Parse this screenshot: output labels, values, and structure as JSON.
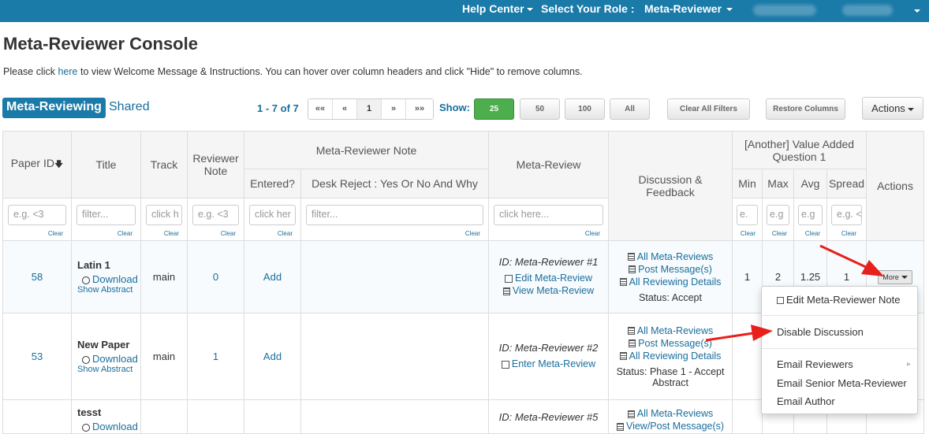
{
  "topbar": {
    "help_center": "Help Center",
    "select_role_label": "Select Your Role :",
    "role": "Meta-Reviewer"
  },
  "page": {
    "title": "Meta-Reviewer Console",
    "instructions_prefix": "Please click ",
    "instructions_link": "here",
    "instructions_suffix": " to view Welcome Message & Instructions. You can hover over column headers and click \"Hide\" to remove columns."
  },
  "tabs": {
    "active": "Meta-Reviewing",
    "shared": "Shared"
  },
  "pagination": {
    "range": "1 - 7 of 7",
    "first": "««",
    "prev": "«",
    "current": "1",
    "next": "»",
    "last": "»»",
    "show_label": "Show:",
    "sizes": [
      "25",
      "50",
      "100",
      "All"
    ]
  },
  "toolbar": {
    "clear_filters": "Clear All Filters",
    "restore_columns": "Restore Columns",
    "actions": "Actions"
  },
  "headers": {
    "paper_id": "Paper ID",
    "title": "Title",
    "track": "Track",
    "reviewer_note_1": "Reviewer",
    "reviewer_note_2": "Note",
    "mr_note": "Meta-Reviewer Note",
    "entered": "Entered?",
    "desk_reject": "Desk Reject : Yes Or No And Why",
    "meta_review": "Meta-Review",
    "discussion_1": "Discussion &",
    "discussion_2": "Feedback",
    "value_added_1": "[Another] Value Added",
    "value_added_2": "Question 1",
    "min": "Min",
    "max": "Max",
    "avg": "Avg",
    "spread": "Spread",
    "actions": "Actions"
  },
  "filters": {
    "paper_id": "e.g. <3",
    "title": "filter...",
    "track": "click h",
    "reviewer_note": "e.g. <3",
    "entered": "click her",
    "desk_reject": "filter...",
    "meta_review": "click here...",
    "min": "e.",
    "max": "e.g",
    "avg": "e.g",
    "spread": "e.g. <",
    "clear": "Clear"
  },
  "rows": [
    {
      "paper_id": "58",
      "title": "Latin 1",
      "download": "Download",
      "show_abstract": "Show Abstract",
      "track": "main",
      "reviewer_note": "0",
      "entered": "Add",
      "mr_id": "ID: Meta-Reviewer #1",
      "mr_action_1": "Edit Meta-Review",
      "mr_action_2": "View Meta-Review",
      "all_meta_reviews": "All Meta-Reviews",
      "post_messages": "Post Message(s)",
      "all_reviewing": "All Reviewing Details",
      "status": "Status: Accept",
      "min": "1",
      "max": "2",
      "avg": "1.25",
      "spread": "1",
      "more": "More"
    },
    {
      "paper_id": "53",
      "title": "New Paper",
      "download": "Download",
      "show_abstract": "Show Abstract",
      "track": "main",
      "reviewer_note": "1",
      "entered": "Add",
      "mr_id": "ID: Meta-Reviewer #2",
      "mr_action_1": "Enter Meta-Review",
      "all_meta_reviews": "All Meta-Reviews",
      "post_messages": "Post Message(s)",
      "all_reviewing": "All Reviewing Details",
      "status_1": "Status: Phase 1 - Accept",
      "status_2": "Abstract"
    },
    {
      "title": "tesst",
      "download": "Download",
      "mr_id": "ID: Meta-Reviewer #5",
      "all_meta_reviews": "All Meta-Reviews",
      "post_messages": "View/Post Message(s)"
    }
  ],
  "dropdown": {
    "edit_note": "Edit Meta-Reviewer Note",
    "disable_discussion": "Disable Discussion",
    "email_reviewers": "Email Reviewers",
    "email_senior": "Email Senior Meta-Reviewer",
    "email_author": "Email Author"
  },
  "colors": {
    "brand": "#1a7aa8",
    "link": "#1a6e9c",
    "green": "#4cae4c",
    "annotation": "#e8201c"
  }
}
